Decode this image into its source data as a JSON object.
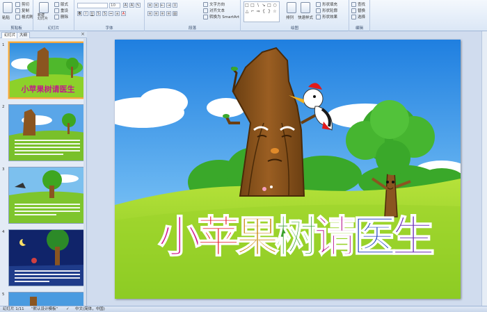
{
  "ribbon": {
    "clipboard": {
      "paste": "粘贴",
      "cut": "剪切",
      "copy": "复制",
      "format_painter": "格式刷",
      "group": "剪贴板"
    },
    "slides": {
      "new_slide": "新建\n幻灯片",
      "layout": "版式",
      "reset": "重设",
      "delete": "删除",
      "group": "幻灯片"
    },
    "font": {
      "font_name": "",
      "font_size": "10",
      "group": "字体"
    },
    "paragraph": {
      "text_direction": "文字方向",
      "align_text": "对齐文本",
      "smartart": "转换为 SmartArt",
      "group": "段落"
    },
    "drawing": {
      "arrange": "排列",
      "quick_styles": "快速样式",
      "fill": "形状填充",
      "outline": "形状轮廓",
      "effects": "形状效果",
      "group": "绘图"
    },
    "editing": {
      "find": "查找",
      "replace": "替换",
      "select": "选择",
      "group": "编辑"
    }
  },
  "left_panel": {
    "tabs": [
      "幻灯片",
      "大纲"
    ],
    "close": "×",
    "slide_numbers": [
      "1",
      "2",
      "3",
      "4",
      "5"
    ]
  },
  "slide": {
    "title": "小苹果树请医生",
    "title_colors": [
      "#d2188a",
      "#e8222e",
      "#c98a10",
      "#3aa12c",
      "#b8188e",
      "#1e3fbf",
      "#6e2fb9"
    ]
  },
  "status_bar": {
    "slide_info": "幻灯片 1/11",
    "theme": "\"默认设计模板\"",
    "language": "中文(简体，中国)"
  }
}
